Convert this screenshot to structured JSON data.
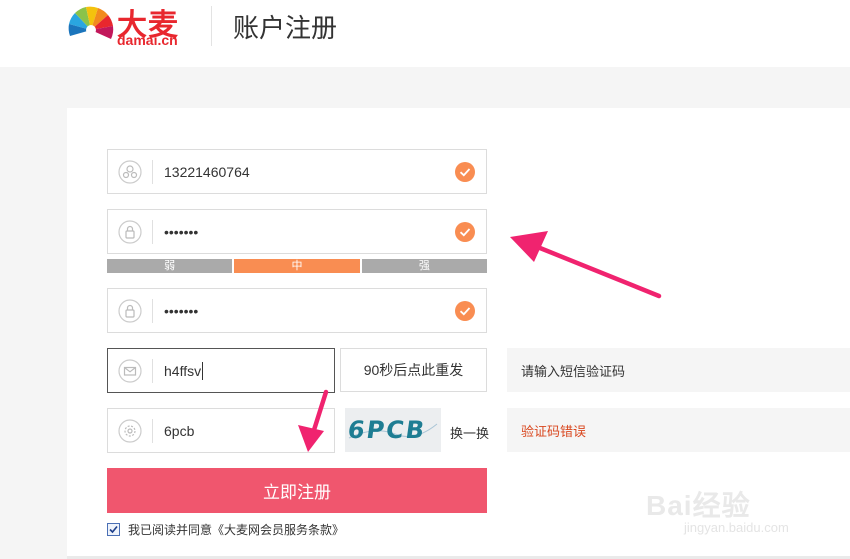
{
  "header": {
    "logo_cn": "大麦",
    "logo_en": "damai.cn",
    "title": "账户注册"
  },
  "form": {
    "phone": {
      "value": "13221460764",
      "icon": "user-icon",
      "valid": true
    },
    "password": {
      "value": "•••••••",
      "icon": "lock-icon",
      "valid": true
    },
    "strength": {
      "labels": [
        "弱",
        "中",
        "强"
      ],
      "level": 2
    },
    "confirm_password": {
      "value": "•••••••",
      "icon": "lock-icon",
      "valid": true
    },
    "sms_code": {
      "value": "h4ffsv",
      "icon": "mail-icon",
      "button_label": "90秒后点此重发",
      "tip": "请输入短信验证码"
    },
    "captcha": {
      "value": "6pcb",
      "icon": "gear-icon",
      "image_text": "6PCB",
      "refresh_label": "换一换",
      "error": "验证码错误"
    },
    "submit_label": "立即注册",
    "agree_label": "我已阅读并同意《大麦网会员服务条款》",
    "agree_checked": true
  },
  "watermark": {
    "main": "Bai经验",
    "sub": "jingyan.baidu.com"
  },
  "colors": {
    "brand": "#e8272e",
    "accent": "#f98d52",
    "submit": "#f0566e",
    "error": "#d9471f",
    "arrow": "#f0236f"
  }
}
